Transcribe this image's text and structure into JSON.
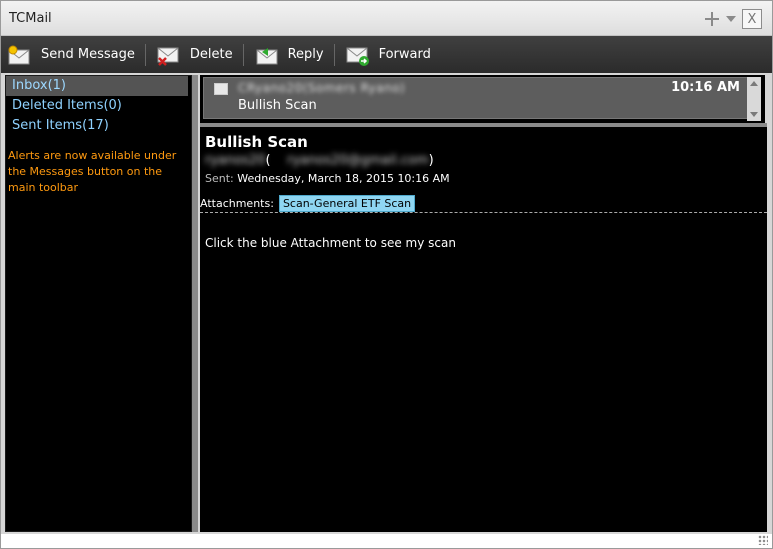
{
  "window": {
    "title": "TCMail"
  },
  "toolbar": {
    "send_label": "Send Message",
    "delete_label": "Delete",
    "reply_label": "Reply",
    "forward_label": "Forward"
  },
  "sidebar": {
    "folders": [
      {
        "label": "Inbox(1)"
      },
      {
        "label": "Deleted Items(0)"
      },
      {
        "label": "Sent Items(17)"
      }
    ],
    "note": "Alerts are now available under the Messages button on the main toolbar"
  },
  "message_list": {
    "items": [
      {
        "sender": "CRyano20(Somers Ryano)",
        "time": "10:16 AM",
        "subject": "Bullish Scan"
      }
    ]
  },
  "reader": {
    "subject": "Bullish Scan",
    "from_name": "ryanos20",
    "from_paren_open": "(",
    "from_email": "ryanos20@gmail.com",
    "from_paren_close": ")",
    "sent_label": "Sent:",
    "sent_value": "Wednesday, March 18, 2015 10:16 AM",
    "attachments_label": "Attachments:",
    "attachment_name": "Scan-General ETF Scan",
    "body": "Click the blue Attachment to see my scan"
  },
  "icons": {
    "title_move": "move-icon",
    "title_menu": "chevron-down-icon",
    "title_close": "close-icon",
    "send": "envelope-star-icon",
    "delete": "envelope-x-icon",
    "reply": "envelope-reply-icon",
    "forward": "envelope-forward-icon"
  },
  "colors": {
    "folder_text": "#8fd2ff",
    "note_text": "#ff9a10",
    "attachment_bg": "#8fd6f2",
    "toolbar_bg": "#353535"
  }
}
